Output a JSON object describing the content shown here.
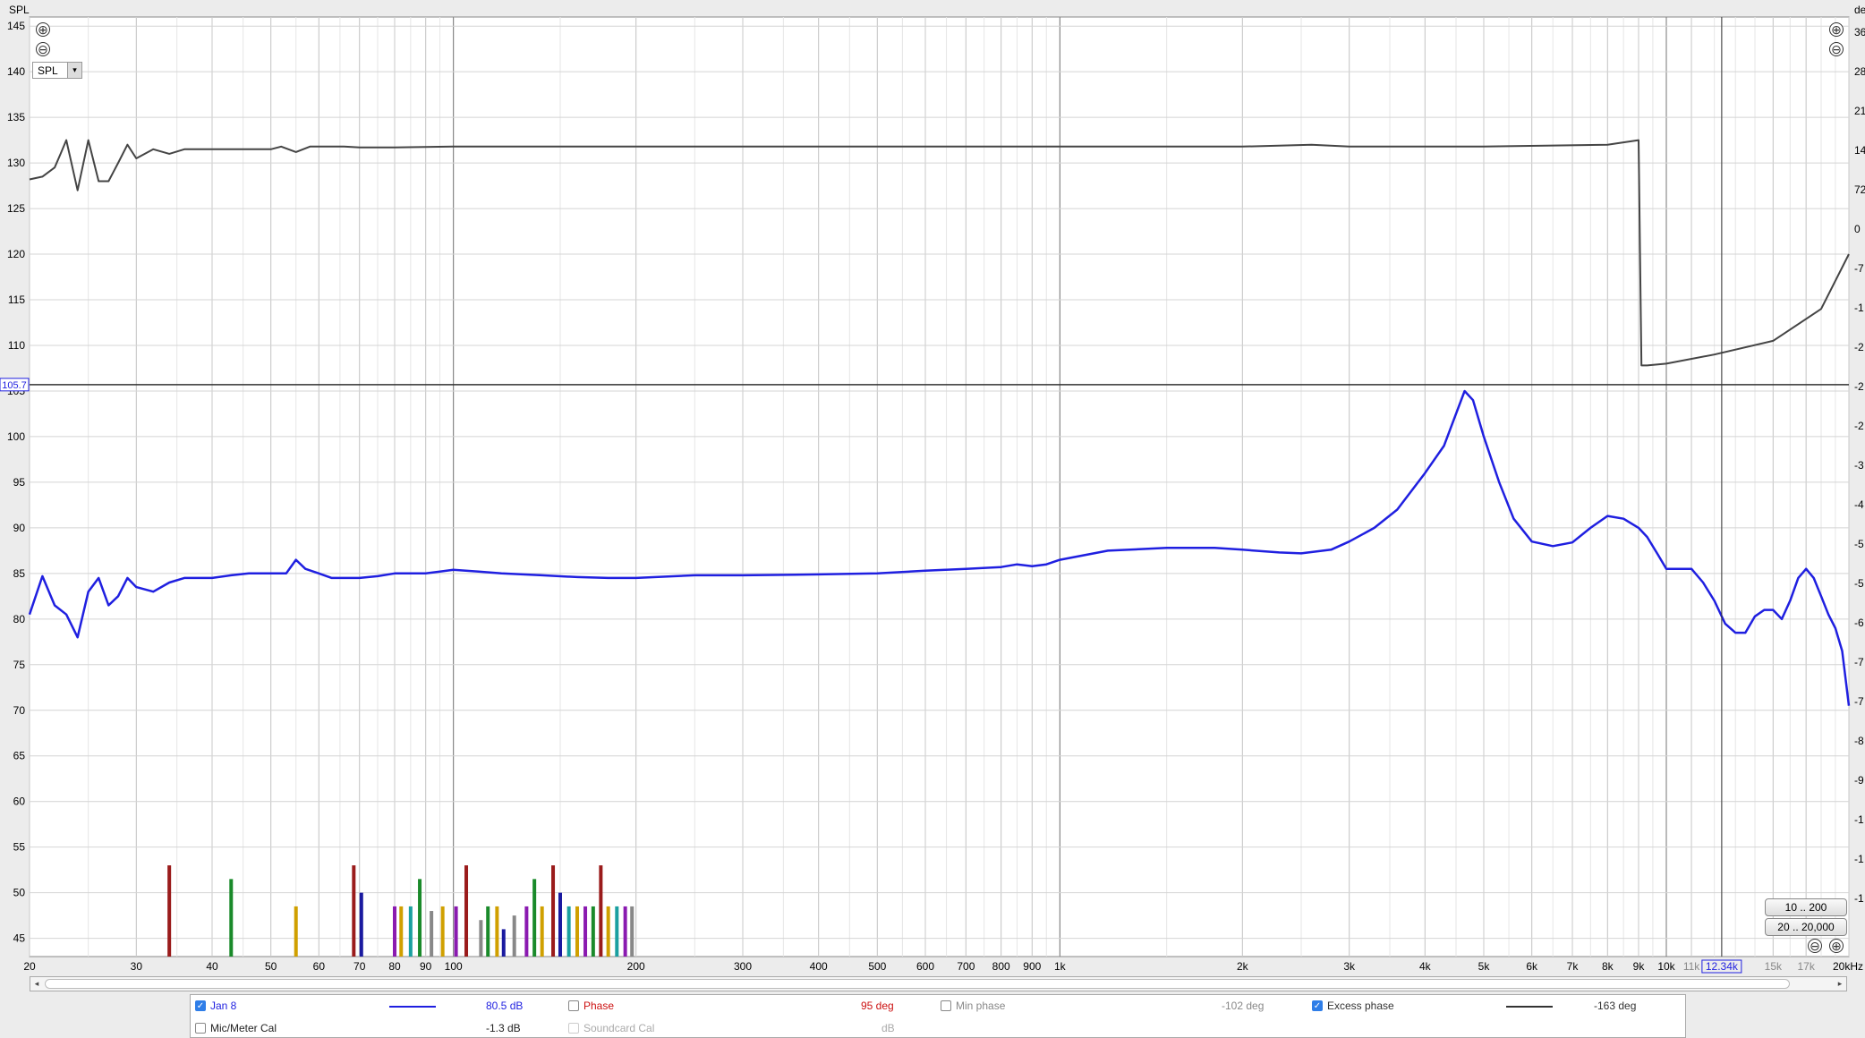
{
  "chart_data": {
    "type": "line",
    "x_scale": "log",
    "xlim": [
      20,
      20000
    ],
    "x_ticks": [
      20,
      30,
      40,
      50,
      60,
      70,
      80,
      90,
      100,
      200,
      300,
      400,
      500,
      600,
      700,
      800,
      900,
      1000,
      2000,
      3000,
      4000,
      5000,
      6000,
      7000,
      8000,
      9000,
      10000,
      11000,
      12340,
      15000,
      17000,
      20000
    ],
    "x_tick_labels": [
      "20",
      "30",
      "40",
      "50",
      "60",
      "70",
      "80",
      "90",
      "100",
      "200",
      "300",
      "400",
      "500",
      "600",
      "700",
      "800",
      "900",
      "1k",
      "2k",
      "3k",
      "4k",
      "5k",
      "6k",
      "7k",
      "8k",
      "9k",
      "10k",
      "11k",
      "12.34k",
      "15k",
      "17k",
      "20kHz"
    ],
    "cursor_x": 12340,
    "cursor_label": "12.34k",
    "y_axis_title": "SPL",
    "y_ticks": [
      145,
      140,
      135,
      130,
      125,
      120,
      115,
      110,
      105,
      100,
      95,
      90,
      85,
      80,
      75,
      70,
      65,
      60,
      55,
      50,
      45
    ],
    "y_tick_labels": [
      "145",
      "140",
      "135",
      "130",
      "125",
      "120",
      "115",
      "110",
      "105",
      "100",
      "95",
      "90",
      "85",
      "80",
      "75",
      "70",
      "65",
      "60",
      "55",
      "50",
      "45"
    ],
    "ylim": [
      43,
      146
    ],
    "cursor_y_label": "105.7",
    "right_axis_title": "de",
    "right_tick_labels": [
      "36",
      "28",
      "21",
      "14",
      "72",
      "0",
      "-7",
      "-1",
      "-2",
      "-2",
      "-2",
      "-3",
      "-4",
      "-5",
      "-5",
      "-6",
      "-7",
      "-7",
      "-8",
      "-9",
      "-1",
      "-1",
      "-1"
    ],
    "grid": true,
    "series": [
      {
        "name": "Jan 8",
        "color": "#1f1fe0",
        "x": [
          20,
          21,
          22,
          23,
          24,
          25,
          26,
          27,
          28,
          29,
          30,
          32,
          34,
          36,
          38,
          40,
          43,
          46,
          50,
          53,
          55,
          57,
          60,
          63,
          66,
          70,
          75,
          80,
          85,
          90,
          95,
          100,
          110,
          120,
          140,
          160,
          180,
          200,
          250,
          300,
          400,
          500,
          600,
          700,
          800,
          850,
          900,
          950,
          1000,
          1200,
          1500,
          1800,
          2000,
          2300,
          2500,
          2800,
          3000,
          3300,
          3600,
          4000,
          4300,
          4500,
          4650,
          4800,
          5000,
          5300,
          5600,
          6000,
          6500,
          7000,
          7500,
          8000,
          8500,
          9000,
          9300,
          9700,
          10000,
          10500,
          11000,
          11500,
          12000,
          12500,
          13000,
          13500,
          14000,
          14500,
          15000,
          15500,
          16000,
          16500,
          17000,
          17500,
          18000,
          18500,
          19000,
          19500,
          20000
        ],
        "y": [
          80.5,
          84.7,
          81.5,
          80.5,
          78,
          83,
          84.5,
          81.5,
          82.5,
          84.5,
          83.5,
          83,
          84,
          84.5,
          84.5,
          84.5,
          84.8,
          85,
          85,
          85,
          86.5,
          85.5,
          85,
          84.5,
          84.5,
          84.5,
          84.7,
          85,
          85,
          85,
          85.2,
          85.4,
          85.2,
          85,
          84.8,
          84.6,
          84.5,
          84.5,
          84.8,
          84.8,
          84.9,
          85,
          85.3,
          85.5,
          85.7,
          86,
          85.8,
          86,
          86.5,
          87.5,
          87.8,
          87.8,
          87.6,
          87.3,
          87.2,
          87.6,
          88.5,
          90,
          92,
          96,
          99,
          102.5,
          105,
          104,
          100,
          95,
          91,
          88.5,
          88,
          88.4,
          90,
          91.3,
          91,
          90,
          89,
          87,
          85.5,
          85.5,
          85.5,
          84,
          82,
          79.5,
          78.5,
          78.5,
          80.3,
          81,
          81,
          80,
          82,
          84.5,
          85.5,
          84.5,
          82.5,
          80.5,
          79,
          76.5,
          70.5
        ]
      },
      {
        "name": "Excess phase",
        "color": "#444444",
        "x": [
          20,
          21,
          22,
          22.5,
          23,
          24,
          25,
          26,
          27,
          28,
          29,
          30,
          32,
          34,
          36,
          38,
          40,
          45,
          50,
          52,
          55,
          58,
          62,
          66,
          70,
          80,
          100,
          200,
          500,
          1000,
          2000,
          2600,
          3000,
          5000,
          8000,
          9000,
          9100,
          9300,
          10000,
          12000,
          15000,
          18000,
          20000
        ],
        "y": [
          128.2,
          128.5,
          129.5,
          131,
          132.5,
          127,
          132.5,
          128,
          128,
          130,
          132,
          130.5,
          131.5,
          131,
          131.5,
          131.5,
          131.5,
          131.5,
          131.5,
          131.8,
          131.2,
          131.8,
          131.8,
          131.8,
          131.7,
          131.7,
          131.8,
          131.8,
          131.8,
          131.8,
          131.8,
          132,
          131.8,
          131.8,
          132,
          132.5,
          107.8,
          107.8,
          108,
          109,
          110.5,
          114,
          120
        ]
      }
    ]
  },
  "controls": {
    "zoom_in": "⊕",
    "zoom_out": "⊖",
    "y_select_value": "SPL",
    "y_select_arrow": "▾",
    "range_10_200": "10 .. 200",
    "range_20_20000": "20 .. 20,000",
    "scroll_left": "◂",
    "scroll_right": "▸"
  },
  "legend": {
    "row1": {
      "item1": {
        "checked": true,
        "label": "Jan 8",
        "value": "80.5 dB",
        "color": "#1f1fe0"
      },
      "item2": {
        "checked": false,
        "label": "Phase",
        "value": "95 deg",
        "color": "#cc1111"
      },
      "item3": {
        "checked": false,
        "label": "Min phase",
        "value": "-102 deg",
        "color": "#888888"
      },
      "item4": {
        "checked": true,
        "label": "Excess phase",
        "value": "-163 deg",
        "color": "#333333"
      }
    },
    "row2": {
      "item1": {
        "checked": false,
        "label": "Mic/Meter Cal",
        "value": "-1.3 dB"
      },
      "item2": {
        "checked": false,
        "label": "Soundcard Cal",
        "value": "dB"
      }
    }
  }
}
